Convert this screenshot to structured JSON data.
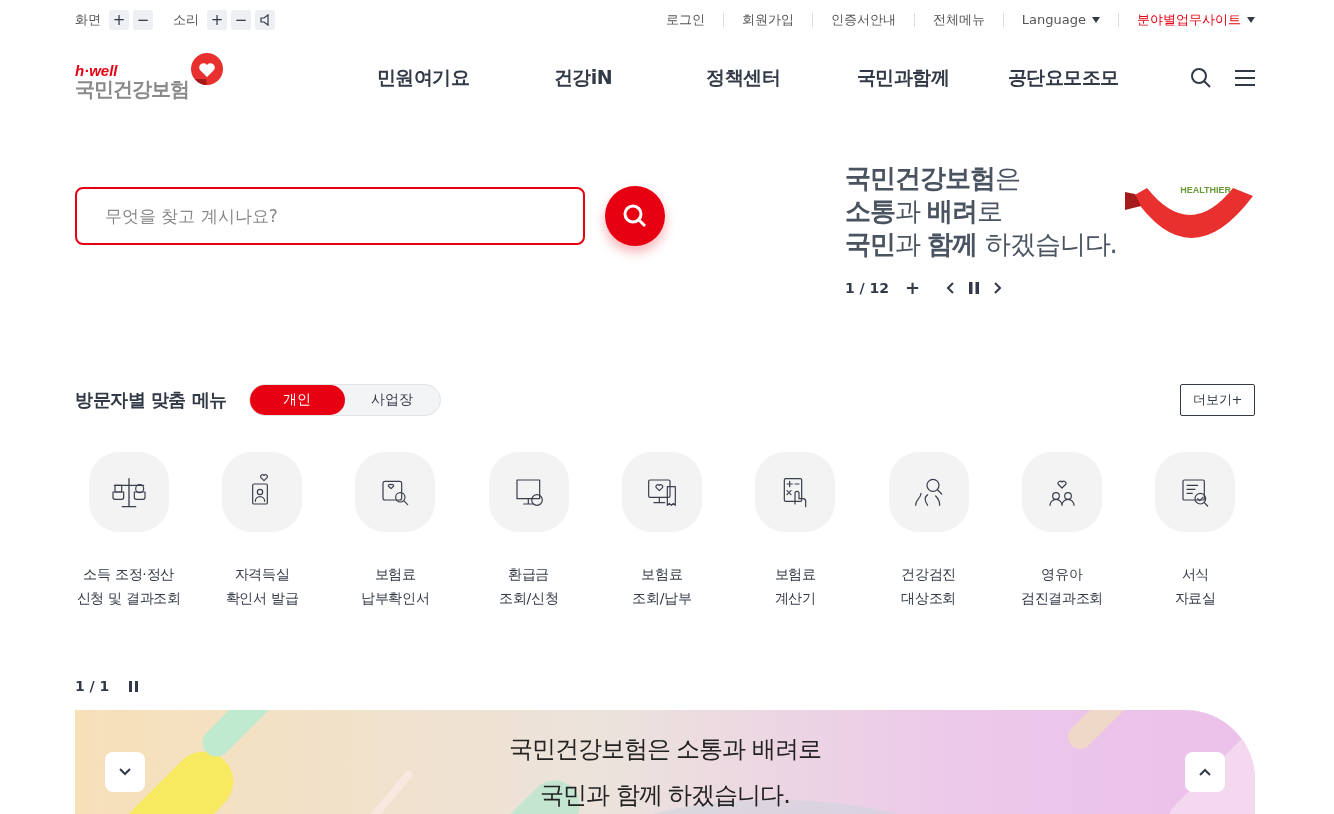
{
  "utility_bar": {
    "screen_label": "화면",
    "screen_buttons": [
      "+",
      "−"
    ],
    "sound_label": "소리",
    "sound_buttons": [
      "+",
      "−"
    ],
    "links": [
      {
        "label": "로그인",
        "dropdown": false,
        "emphasized": false
      },
      {
        "label": "회원가입",
        "dropdown": false,
        "emphasized": false
      },
      {
        "label": "인증서안내",
        "dropdown": false,
        "emphasized": false
      },
      {
        "label": "전체메뉴",
        "dropdown": false,
        "emphasized": false
      },
      {
        "label": "Language",
        "dropdown": true,
        "emphasized": false
      },
      {
        "label": "분야별업무사이트",
        "dropdown": true,
        "emphasized": true
      }
    ]
  },
  "header": {
    "logo_tagline": "h·well",
    "logo_name": "국민건강보험",
    "nav": [
      "민원여기요",
      "건강iN",
      "정책센터",
      "국민과함께",
      "공단요모조모"
    ]
  },
  "search": {
    "placeholder": "무엇을 찾고 계시나요?"
  },
  "slogan": {
    "lines": [
      "**국민건강보험**은",
      "**소통**과 **배려**로",
      "**국민**과 **함께** 하겠습니다."
    ],
    "ribbon_text": "HEALTHIER",
    "counter": "1 / 12",
    "add": "+"
  },
  "custom_menu": {
    "title": "방문자별 맞춤 메뉴",
    "tabs": [
      {
        "label": "개인",
        "selected": true
      },
      {
        "label": "사업장",
        "selected": false
      }
    ],
    "more": "더보기+",
    "items": [
      {
        "lines": [
          "소득 조정·정산",
          "신청 및 결과조회"
        ]
      },
      {
        "lines": [
          "자격득실",
          "확인서 발급"
        ]
      },
      {
        "lines": [
          "보험료",
          "납부확인서"
        ]
      },
      {
        "lines": [
          "환급금",
          "조회/신청"
        ]
      },
      {
        "lines": [
          "보험료",
          "조회/납부"
        ]
      },
      {
        "lines": [
          "보험료",
          "계산기"
        ]
      },
      {
        "lines": [
          "건강검진",
          "대상조회"
        ]
      },
      {
        "lines": [
          "영유아",
          "검진결과조회"
        ]
      },
      {
        "lines": [
          "서식",
          "자료실"
        ]
      }
    ]
  },
  "banner": {
    "counter": "1 / 1",
    "lines": [
      "국민건강보험은 소통과 배려로",
      "국민과 함께 하겠습니다."
    ]
  }
}
